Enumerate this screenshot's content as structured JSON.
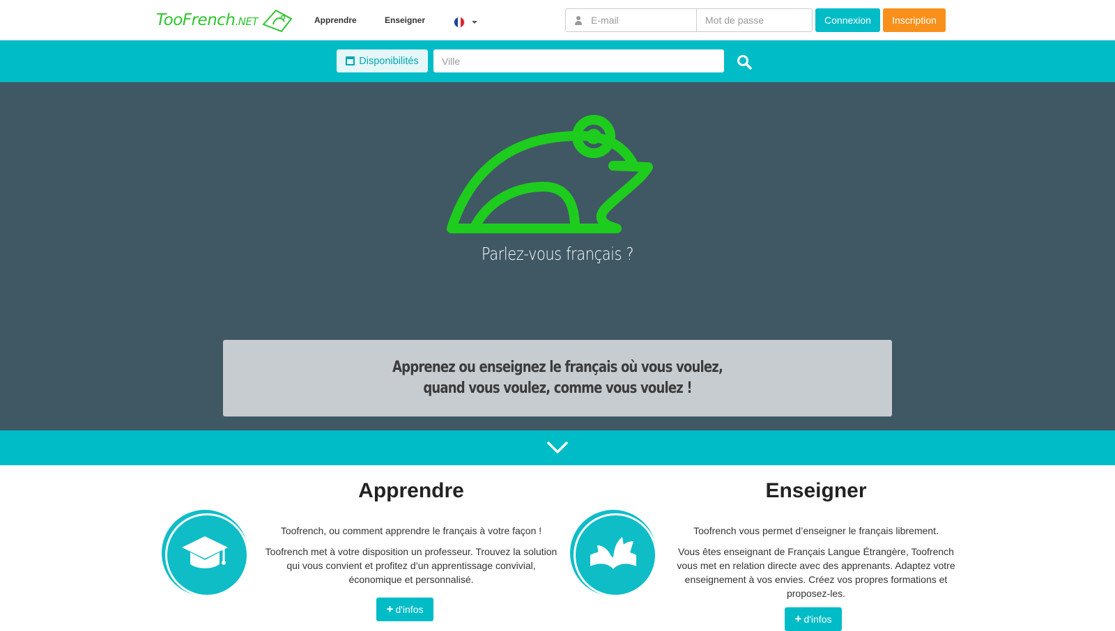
{
  "brand": {
    "name_part1": "Too",
    "name_part2": "French",
    "name_part3": ".NET",
    "color": "#2ec52e"
  },
  "nav": {
    "learn": "Apprendre",
    "teach": "Enseigner",
    "language": "fr"
  },
  "login": {
    "email_placeholder": "E-mail",
    "password_placeholder": "Mot de passe",
    "login_label": "Connexion",
    "signup_label": "Inscription"
  },
  "search": {
    "availability_label": "Disponibilités",
    "city_placeholder": "Ville"
  },
  "hero": {
    "tagline": "Parlez-vous français ?",
    "banner_line1": "Apprenez ou enseignez le français où vous voulez,",
    "banner_line2": "quand vous voulez, comme vous voulez !"
  },
  "features": {
    "learn": {
      "title": "Apprendre",
      "lead": "Toofrench, ou comment apprendre le français à votre façon !",
      "desc": "Toofrench met à votre disposition un professeur. Trouvez la solution qui vous convient et profitez d’un apprentissage convivial, économique et personnalisé.",
      "button": "d'infos"
    },
    "teach": {
      "title": "Enseigner",
      "lead": "Toofrench vous permet d’enseigner le français librement.",
      "desc": "Vous êtes enseignant de Français Langue Étrangère, Toofrench vous met en relation directe avec des apprenants. Adaptez votre enseignement à vos envies. Créez vos propres formations et proposez-les.",
      "button": "d'infos"
    }
  },
  "colors": {
    "teal": "#00bcc7",
    "orange": "#f8901b",
    "hero_bg": "#3f5864",
    "frog_green": "#1ecc1e"
  }
}
